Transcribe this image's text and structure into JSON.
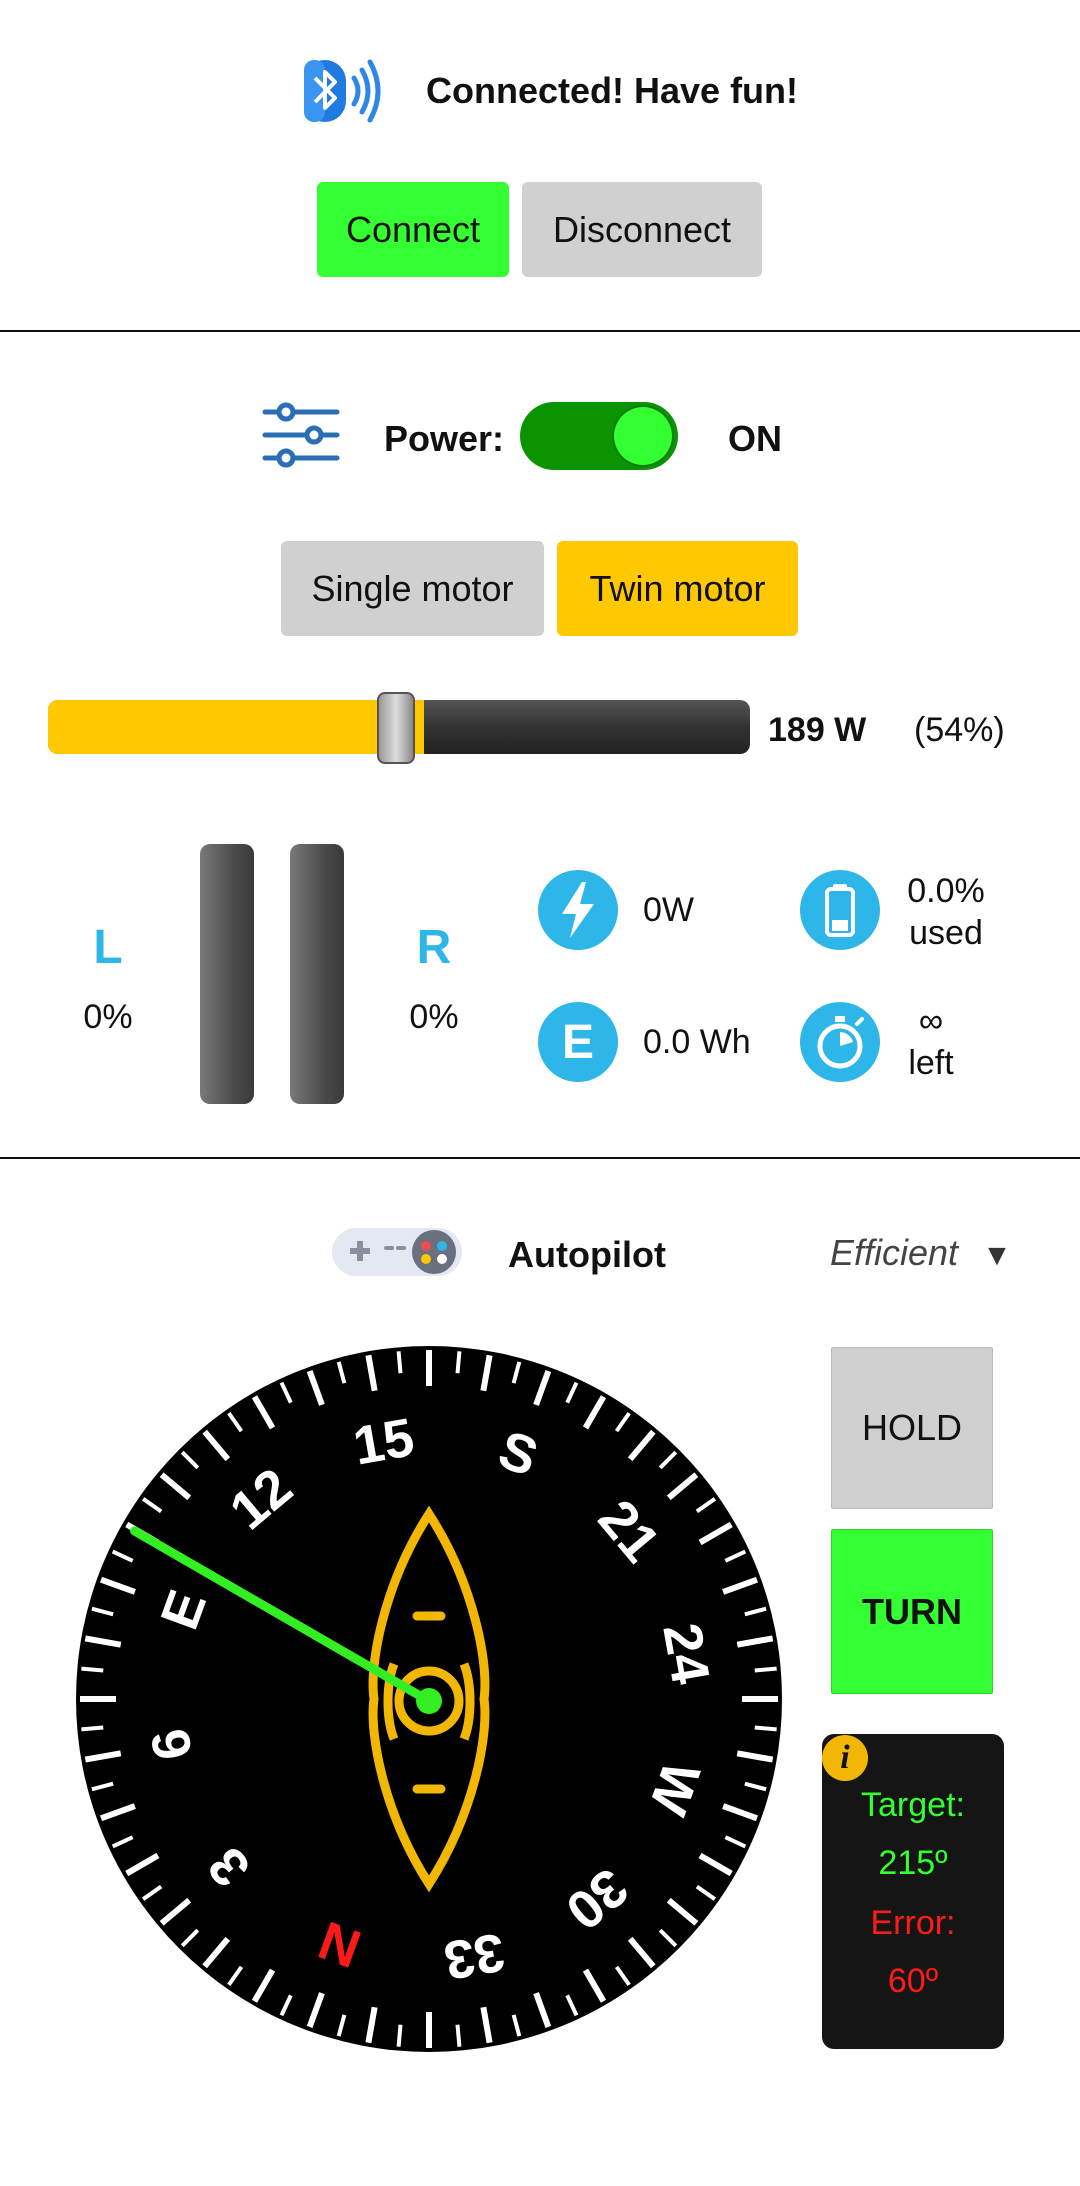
{
  "connection": {
    "status": "Connected! Have fun!",
    "connect_label": "Connect",
    "disconnect_label": "Disconnect",
    "icon": "bluetooth-icon"
  },
  "power": {
    "label": "Power:",
    "state": "ON",
    "toggle_on": true,
    "icon": "settings-sliders-icon"
  },
  "motor_mode": {
    "single_label": "Single motor",
    "twin_label": "Twin motor",
    "selected": "Twin motor"
  },
  "throttle": {
    "level_fraction": 0.54,
    "watts_text": "189 W",
    "percent_text": "(54%)"
  },
  "motors": {
    "left_label": "L",
    "left_value": "0%",
    "right_label": "R",
    "right_value": "0%"
  },
  "stats": {
    "power_value": "0W",
    "energy_value": "0.0 Wh",
    "battery_used_line1": "0.0%",
    "battery_used_line2": "used",
    "time_left_line1": "∞",
    "time_left_line2": "left"
  },
  "autopilot": {
    "label": "Autopilot",
    "mode": "Efficient",
    "mode_arrow": "▼",
    "hold_label": "HOLD",
    "turn_label": "TURN",
    "info_icon": "info-icon",
    "target_label": "Target:",
    "target_value": "215º",
    "error_label": "Error:",
    "error_value": "60º"
  },
  "compass": {
    "labels": [
      "N",
      "3",
      "6",
      "E",
      "12",
      "15",
      "S",
      "21",
      "24",
      "W",
      "30",
      "33"
    ],
    "needle_heading_deg": 240,
    "colors": {
      "face": "#000000",
      "ticks": "#ffffff",
      "north": "#ff1a1a",
      "needle": "#33ee22",
      "kayak": "#f2b705"
    }
  },
  "colors": {
    "connect_green": "#33ff33",
    "twin_yellow": "#ffc800",
    "neutral_gray": "#d0d0d0",
    "accent_blue": "#2eb6e8",
    "target_green": "#33ff33",
    "error_red": "#ff1a1a"
  }
}
